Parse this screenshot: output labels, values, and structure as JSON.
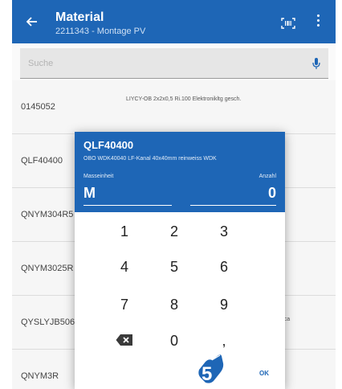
{
  "appbar": {
    "title": "Material",
    "subtitle": "2211343 - Montage PV",
    "icons": {
      "back": "arrow-left-icon",
      "scan": "barcode-scan-icon",
      "more": "more-vertical-icon"
    }
  },
  "search": {
    "placeholder": "Suche",
    "value": "",
    "icon": "microphone-icon"
  },
  "list": [
    {
      "code": "0145052",
      "desc": "LIYCY-OB  2x2x0,5  Ri.100 Elektronikltg gesch.",
      "desc_right": ""
    },
    {
      "code": "QLF40400",
      "desc": "",
      "desc_right": ""
    },
    {
      "code": "QNYM304R5",
      "desc": "",
      "desc_right": ""
    },
    {
      "code": "QNYM3025R",
      "desc": "",
      "desc_right": ""
    },
    {
      "code": "QYSLYJB506",
      "desc": "",
      "desc_right": "ern Eca"
    },
    {
      "code": "QNYM3R",
      "desc": "",
      "desc_right": ""
    }
  ],
  "dialog": {
    "code": "QLF40400",
    "description": "OBO WDK40040 LF-Kanal 40x40mm reinweiss WDK",
    "unit_label": "Masseinheit",
    "qty_label": "Anzahl",
    "unit_value": "M",
    "qty_value": "0",
    "keypad": {
      "k1": "1",
      "k2": "2",
      "k3": "3",
      "k4": "4",
      "k5": "5",
      "k6": "6",
      "k7": "7",
      "k8": "8",
      "k9": "9",
      "k0": "0",
      "kcomma": ",",
      "ok": "OK",
      "backspace_icon": "backspace-icon"
    }
  },
  "annotation": {
    "step": "5",
    "color": "#1e66b6"
  },
  "colors": {
    "primary": "#1e66b6",
    "list_bg": "#f6f6f6",
    "search_bg": "#e6e6e6"
  }
}
